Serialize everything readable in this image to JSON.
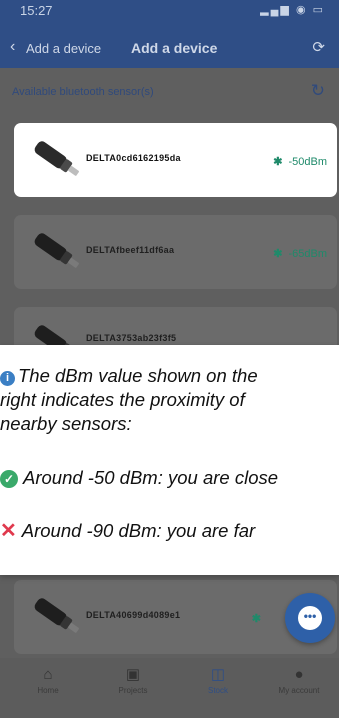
{
  "status_bar": {
    "time": "15:27",
    "icons": "▂▄▆ ◉ ▭"
  },
  "header": {
    "back_label": "Add a device",
    "title": "Add a device"
  },
  "section": {
    "label": "Available bluetooth sensor(s)"
  },
  "devices": [
    {
      "name": "DELTA0cd6162195da",
      "signal": "-50dBm",
      "selected": true
    },
    {
      "name": "DELTAfbeef11df6aa",
      "signal": "-65dBm",
      "selected": false
    },
    {
      "name": "DELTA3753ab23f3f5",
      "signal": "",
      "selected": false
    },
    {
      "name": "DELTA40699d4089e1",
      "signal": "",
      "selected": false
    }
  ],
  "info": {
    "line1": "The dBm value shown on the",
    "line2": "right indicates the proximity of",
    "line3": "nearby sensors:",
    "close": "Around -50 dBm: you are close",
    "far": "Around -90 dBm: you are far"
  },
  "nav": [
    {
      "label": "Home",
      "icon": "home-icon",
      "active": false
    },
    {
      "label": "Projects",
      "icon": "briefcase-icon",
      "active": false
    },
    {
      "label": "Stock",
      "icon": "box-icon",
      "active": true
    },
    {
      "label": "My account",
      "icon": "user-icon",
      "active": false
    }
  ],
  "colors": {
    "primary": "#2f4e86",
    "signal": "#1f8a6a",
    "check": "#3aa96a",
    "cross": "#e0394d"
  }
}
